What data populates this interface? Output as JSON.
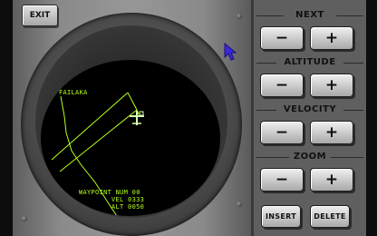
{
  "exit_label": "EXIT",
  "radar": {
    "waypoint_name": "FAILAKA",
    "readout": [
      "WAYPOINT NUM 00",
      "VEL 0333",
      "ALT 0050"
    ],
    "line_color": "#b6ff1a",
    "aircraft_color": "#d7ffb2"
  },
  "controls": {
    "sections": [
      {
        "title": "NEXT",
        "minus": "−",
        "plus": "+"
      },
      {
        "title": "ALTITUDE",
        "minus": "−",
        "plus": "+"
      },
      {
        "title": "VELOCITY",
        "minus": "−",
        "plus": "+"
      },
      {
        "title": "ZOOM",
        "minus": "−",
        "plus": "+"
      }
    ],
    "insert_label": "INSERT",
    "delete_label": "DELETE"
  },
  "pointer_icon": "arrow-cursor-icon"
}
